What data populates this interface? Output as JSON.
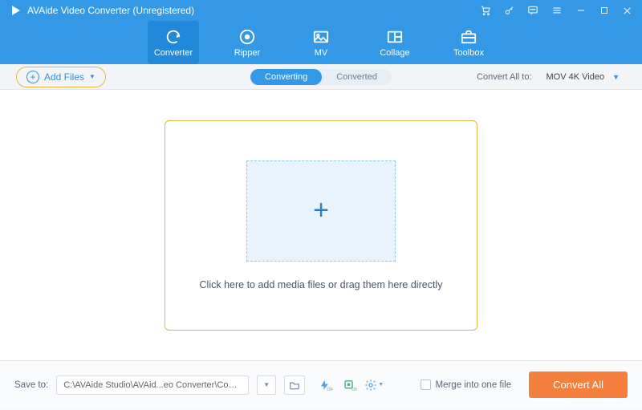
{
  "app": {
    "title": "AVAide Video Converter (Unregistered)"
  },
  "tabs": {
    "converter": "Converter",
    "ripper": "Ripper",
    "mv": "MV",
    "collage": "Collage",
    "toolbox": "Toolbox"
  },
  "subbar": {
    "add_files": "Add Files",
    "mode_converting": "Converting",
    "mode_converted": "Converted",
    "convert_all_to_label": "Convert All to:",
    "convert_all_format": "MOV 4K Video"
  },
  "dropzone": {
    "text": "Click here to add media files or drag them here directly"
  },
  "bottom": {
    "save_to_label": "Save to:",
    "path": "C:\\AVAide Studio\\AVAid...eo Converter\\Converted",
    "merge_label": "Merge into one file",
    "convert_all_btn": "Convert All"
  }
}
